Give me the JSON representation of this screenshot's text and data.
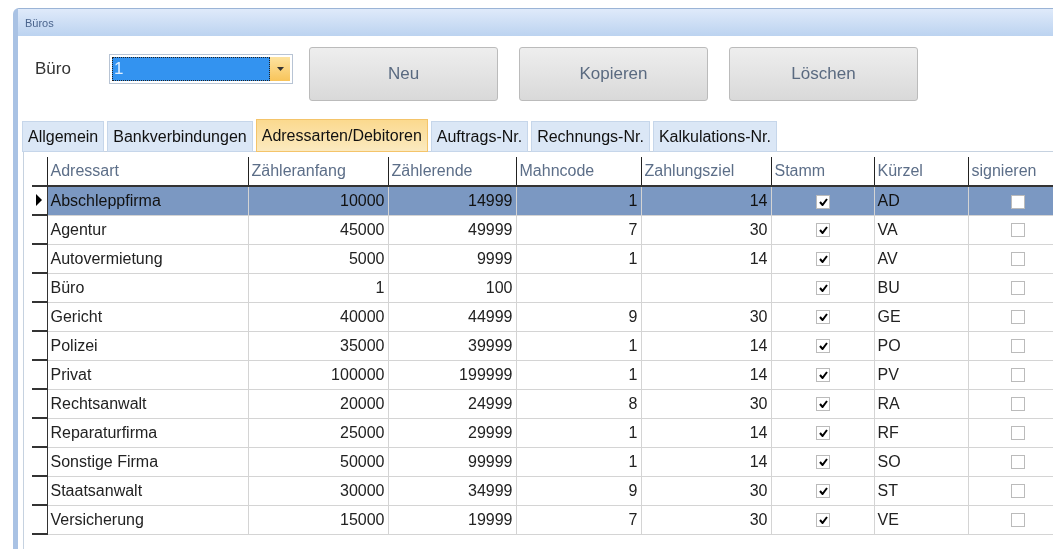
{
  "window": {
    "title": "Büros"
  },
  "office": {
    "label": "Büro",
    "value": "1"
  },
  "buttons": [
    "Neu",
    "Kopieren",
    "Löschen"
  ],
  "tabs": [
    {
      "label": "Allgemein",
      "selected": false
    },
    {
      "label": "Bankverbindungen",
      "selected": false
    },
    {
      "label": "Adressarten/Debitoren",
      "selected": true
    },
    {
      "label": "Auftrags-Nr.",
      "selected": false
    },
    {
      "label": "Rechnungs-Nr.",
      "selected": false
    },
    {
      "label": "Kalkulations-Nr.",
      "selected": false
    }
  ],
  "table": {
    "columns": [
      "Adressart",
      "Zähleranfang",
      "Zählerende",
      "Mahncode",
      "Zahlungsziel",
      "Stamm",
      "Kürzel",
      "signieren"
    ],
    "rows": [
      {
        "adressart": "Abschleppfirma",
        "start": "10000",
        "end": "14999",
        "mahncode": "1",
        "ziel": "14",
        "stamm": true,
        "kuerzel": "AD",
        "signieren": false,
        "selected": true
      },
      {
        "adressart": "Agentur",
        "start": "45000",
        "end": "49999",
        "mahncode": "7",
        "ziel": "30",
        "stamm": true,
        "kuerzel": "VA",
        "signieren": false,
        "selected": false
      },
      {
        "adressart": "Autovermietung",
        "start": "5000",
        "end": "9999",
        "mahncode": "1",
        "ziel": "14",
        "stamm": true,
        "kuerzel": "AV",
        "signieren": false,
        "selected": false
      },
      {
        "adressart": "Büro",
        "start": "1",
        "end": "100",
        "stamm": true,
        "kuerzel": "BU",
        "signieren": false,
        "selected": false
      },
      {
        "adressart": "Gericht",
        "start": "40000",
        "end": "44999",
        "mahncode": "9",
        "ziel": "30",
        "stamm": true,
        "kuerzel": "GE",
        "signieren": false,
        "selected": false
      },
      {
        "adressart": "Polizei",
        "start": "35000",
        "end": "39999",
        "mahncode": "1",
        "ziel": "14",
        "stamm": true,
        "kuerzel": "PO",
        "signieren": false,
        "selected": false
      },
      {
        "adressart": "Privat",
        "start": "100000",
        "end": "199999",
        "mahncode": "1",
        "ziel": "14",
        "stamm": true,
        "kuerzel": "PV",
        "signieren": false,
        "selected": false
      },
      {
        "adressart": "Rechtsanwalt",
        "start": "20000",
        "end": "24999",
        "mahncode": "8",
        "ziel": "30",
        "stamm": true,
        "kuerzel": "RA",
        "signieren": false,
        "selected": false
      },
      {
        "adressart": "Reparaturfirma",
        "start": "25000",
        "end": "29999",
        "mahncode": "1",
        "ziel": "14",
        "stamm": true,
        "kuerzel": "RF",
        "signieren": false,
        "selected": false
      },
      {
        "adressart": "Sonstige Firma",
        "start": "50000",
        "end": "99999",
        "mahncode": "1",
        "ziel": "14",
        "stamm": true,
        "kuerzel": "SO",
        "signieren": false,
        "selected": false
      },
      {
        "adressart": "Staatsanwalt",
        "start": "30000",
        "end": "34999",
        "mahncode": "9",
        "ziel": "30",
        "stamm": true,
        "kuerzel": "ST",
        "signieren": false,
        "selected": false
      },
      {
        "adressart": "Versicherung",
        "start": "15000",
        "end": "19999",
        "mahncode": "7",
        "ziel": "30",
        "stamm": true,
        "kuerzel": "VE",
        "signieren": false,
        "selected": false
      }
    ]
  }
}
